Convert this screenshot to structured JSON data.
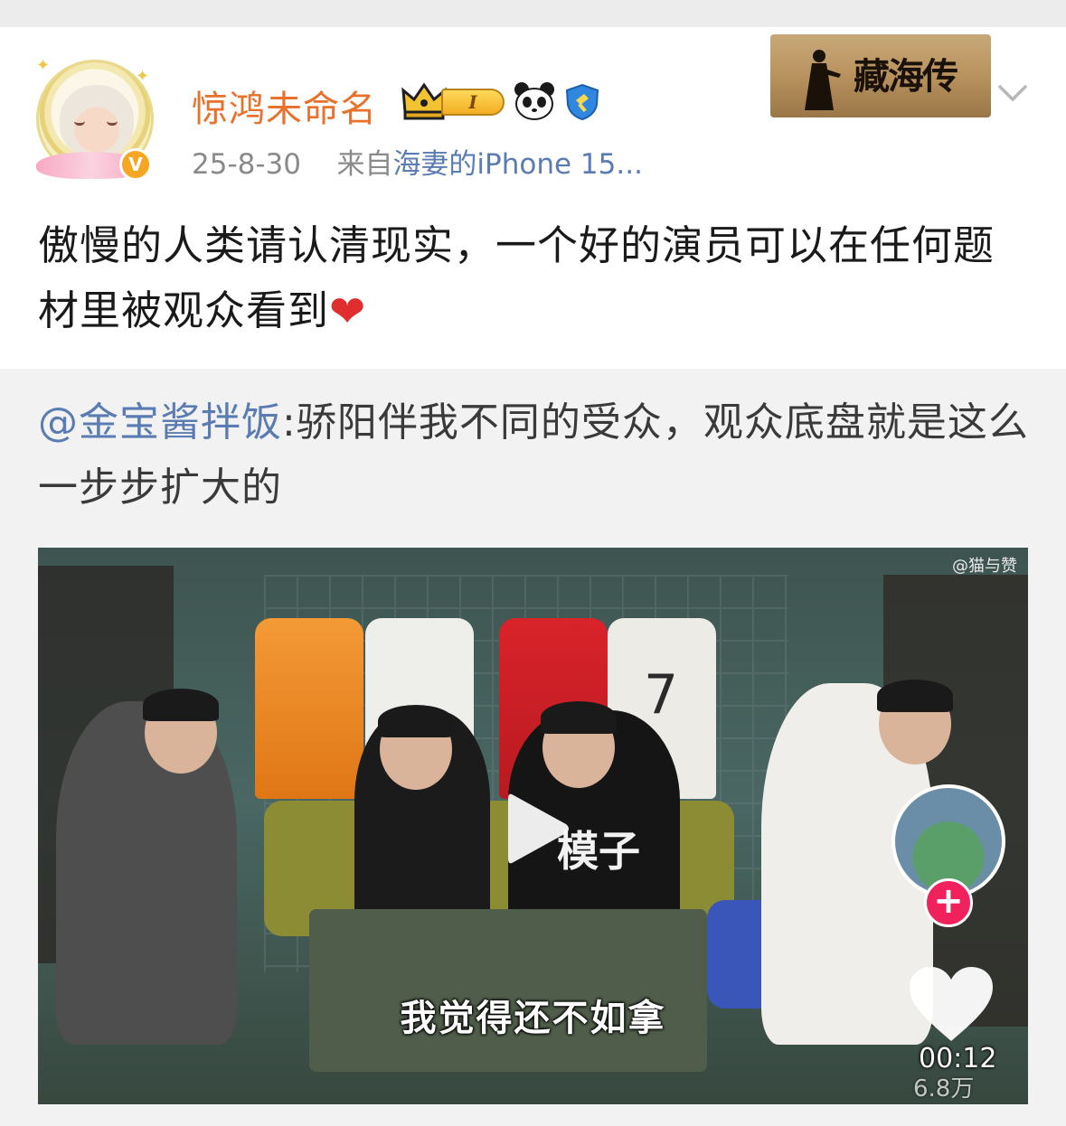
{
  "post": {
    "username": "惊鸿未命名",
    "level_badge": "I",
    "date": "25-8-30",
    "source_prefix": "来自",
    "source_device": "海妻的iPhone 15...",
    "banner_text": "藏海传",
    "text": "傲慢的人类请认清现实，一个好的演员可以在任何题材里被观众看到",
    "emoji": "❤"
  },
  "repost": {
    "mention": "@金宝酱拌饭",
    "text": ":骄阳伴我不同的受众，观众底盘就是这么一步步扩大的"
  },
  "video": {
    "watermark": "@猫与赞",
    "jersey_number": "7",
    "shirt_text": "模子",
    "subtitle": "我觉得还不如拿",
    "time": "00:12",
    "count": "6.8万"
  },
  "colors": {
    "username": "#e8712b",
    "link": "#5a7cb3",
    "like_plus": "#f0215c"
  },
  "icons": [
    "crown-icon",
    "panda-icon",
    "shield-icon",
    "chevron-down-icon",
    "play-icon",
    "heart-icon",
    "plus-icon",
    "verified-icon"
  ]
}
